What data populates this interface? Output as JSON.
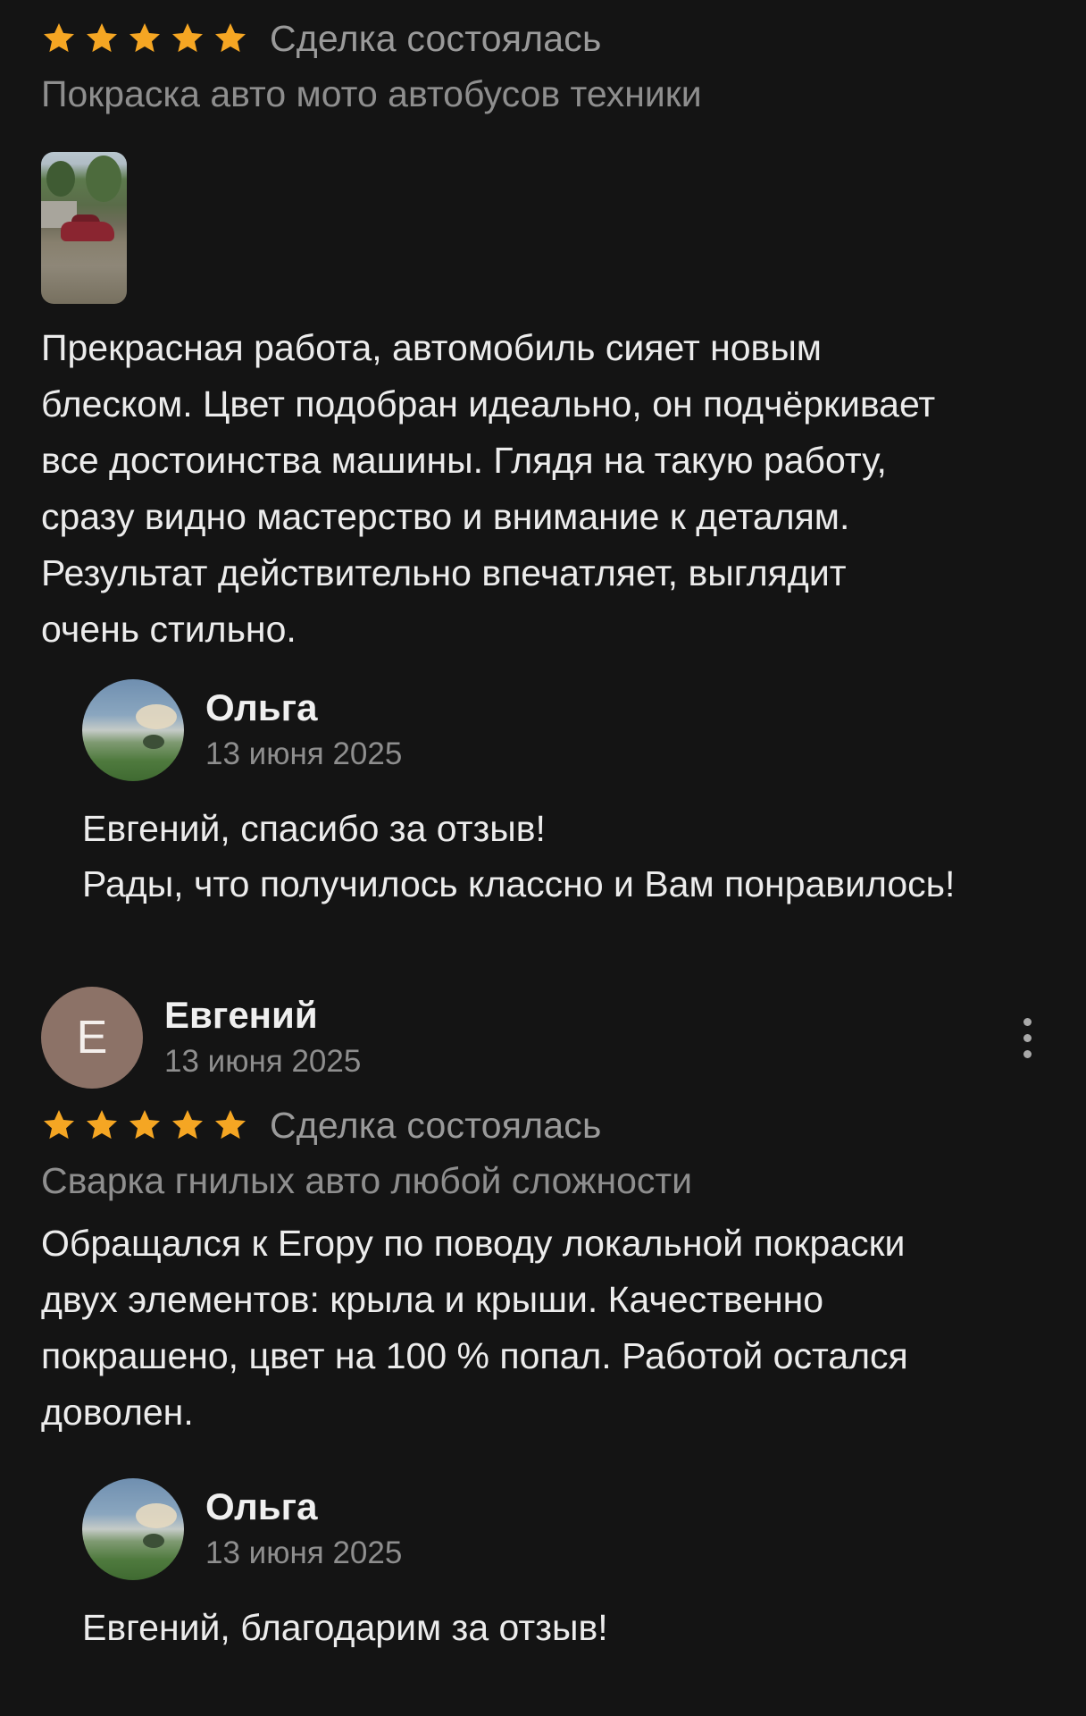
{
  "colors": {
    "background": "#141414",
    "star": "#f5a623",
    "text": "#ececec",
    "muted": "#8e8e8e",
    "avatar_letter_bg": "#8c7267"
  },
  "reviews": [
    {
      "rating": 5,
      "deal_status": "Сделка состоялась",
      "service": "Покраска авто мото автобусов техники",
      "has_photo": true,
      "text": "Прекрасная работа, автомобиль сияет новым\nблеском.  Цвет подобран идеально, он подчёркивает\nвсе достоинства машины.  Глядя на такую работу,\nсразу видно мастерство и  внимание к деталям.\nРезультат действительно впечатляет,  выглядит\nочень стильно.",
      "reply": {
        "author": "Ольга",
        "date": "13 июня 2025",
        "text": "Евгений, спасибо за отзыв!\nРады, что получилось классно и Вам понравилось!"
      }
    },
    {
      "author": "Евгений",
      "author_initial": "Е",
      "date": "13 июня 2025",
      "more_icon": "more-vertical-icon",
      "rating": 5,
      "deal_status": "Сделка состоялась",
      "service": "Сварка гнилых авто любой сложности",
      "text": "Обращался к Егору по поводу локальной покраски\nдвух элементов: крыла и крыши. Качественно\nпокрашено, цвет на 100 % попал. Работой остался\nдоволен.",
      "reply": {
        "author": "Ольга",
        "date": "13 июня 2025",
        "text": "Евгений, благодарим за отзыв!"
      }
    }
  ]
}
